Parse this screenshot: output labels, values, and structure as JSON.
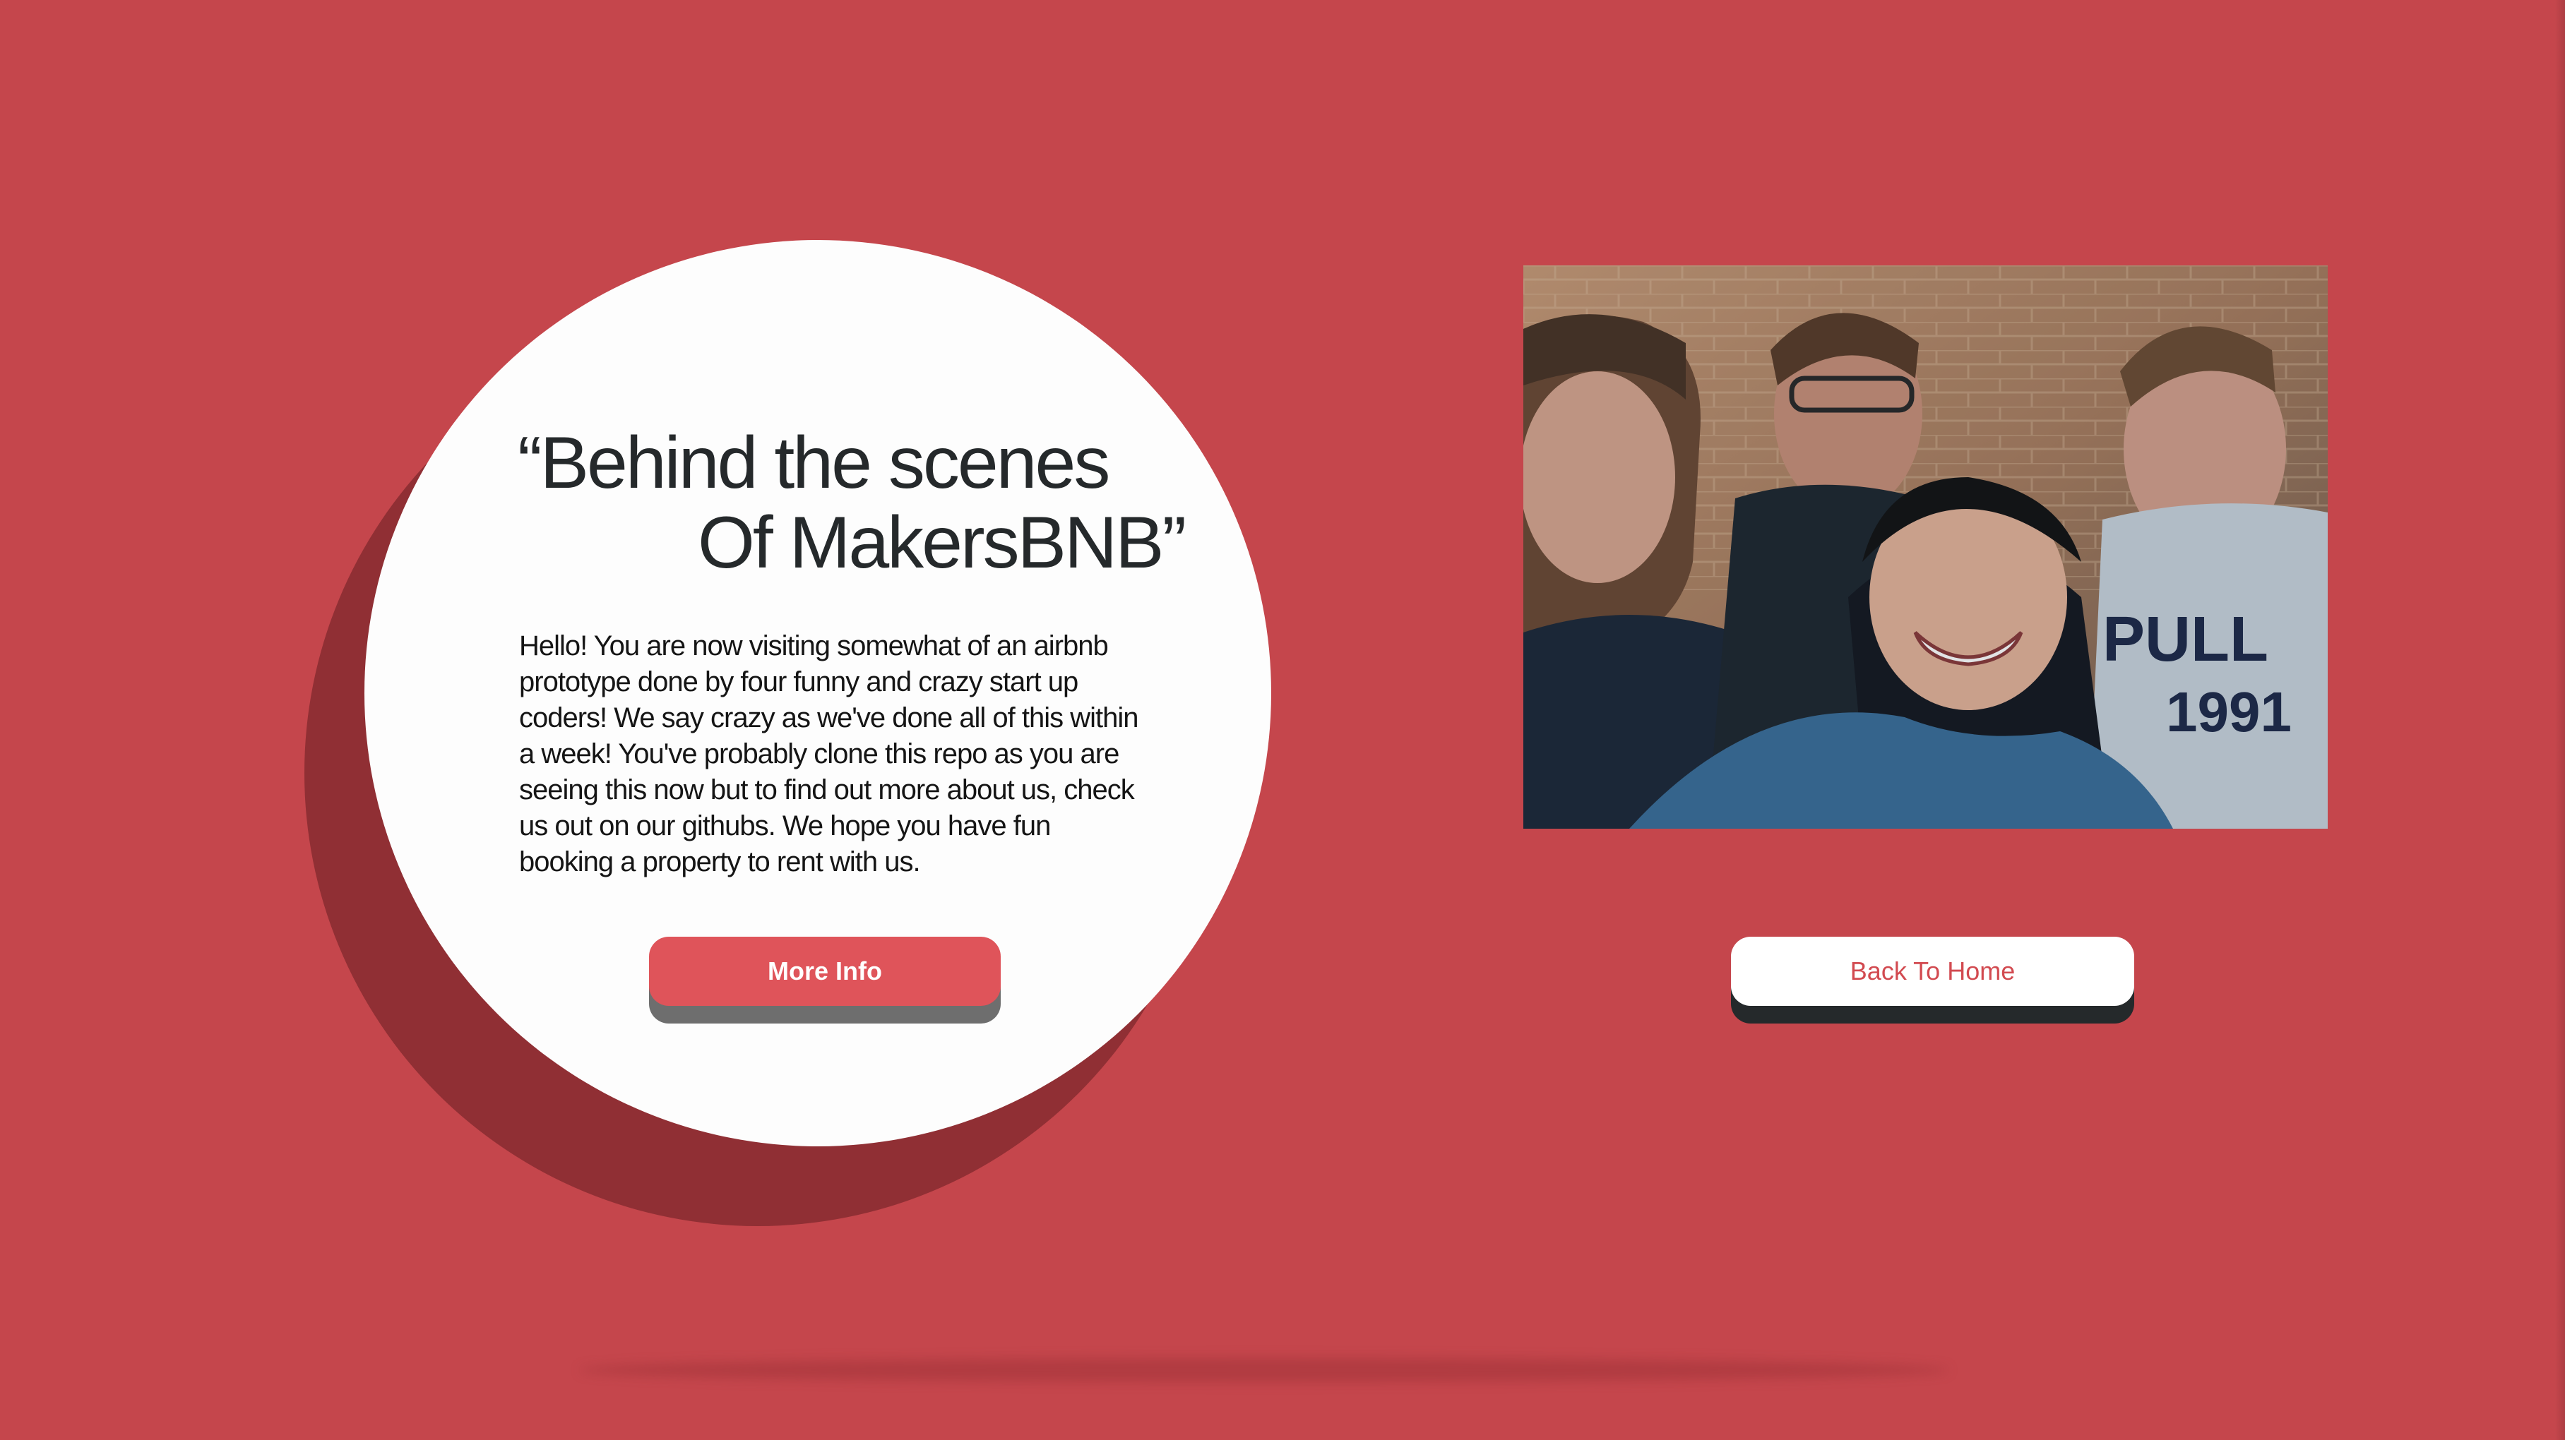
{
  "hero": {
    "heading_line1": "“Behind the scenes",
    "heading_line2": "Of MakersBNB”",
    "description": "Hello! You are now visiting somewhat of an airbnb prototype done by four funny and crazy start up coders! We say crazy as we've done all of this within a week! You've probably clone this repo as you are seeing this now but to find out more about us, check us out on our githubs. We hope you have fun booking a property to rent with us.",
    "more_info_label": "More Info"
  },
  "photo": {
    "alt": "team-photo"
  },
  "navigation": {
    "back_home_label": "Back To Home"
  },
  "colors": {
    "background": "#c5464c",
    "circle": "#fdfdfd",
    "circle_shadow": "#902f34",
    "accent_button": "#df545a",
    "link_text": "#d24a50"
  }
}
